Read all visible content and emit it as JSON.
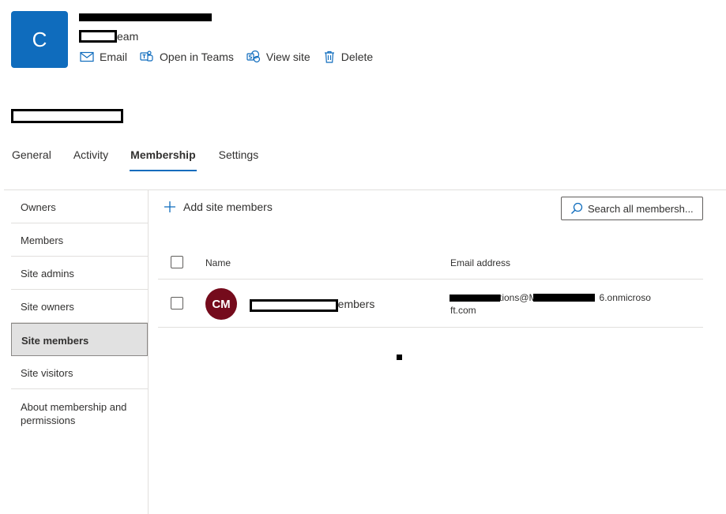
{
  "group": {
    "avatar_letter": "C",
    "subtitle_suffix": "eam"
  },
  "actions": [
    {
      "label": "Email",
      "icon": "mail-icon"
    },
    {
      "label": "Open in Teams",
      "icon": "teams-icon"
    },
    {
      "label": "View site",
      "icon": "sharepoint-icon"
    },
    {
      "label": "Delete",
      "icon": "trash-icon"
    }
  ],
  "tabs": [
    {
      "label": "General"
    },
    {
      "label": "Activity"
    },
    {
      "label": "Membership",
      "active": true
    },
    {
      "label": "Settings"
    }
  ],
  "sidebar": {
    "items": [
      {
        "label": "Owners"
      },
      {
        "label": "Members"
      },
      {
        "label": "Site admins"
      },
      {
        "label": "Site owners"
      },
      {
        "label": "Site members",
        "active": true
      },
      {
        "label": "Site visitors"
      },
      {
        "label": "About membership and permissions"
      }
    ]
  },
  "toolbar": {
    "add_label": "Add site members",
    "search_placeholder": "Search all membersh..."
  },
  "table": {
    "col_name": "Name",
    "col_email": "Email address",
    "rows": [
      {
        "initials": "CM",
        "name_suffix": "Members",
        "email_line1_mid": "tions@M",
        "email_line1_end": "6.onmicroso",
        "email_line2": "ft.com"
      }
    ]
  },
  "colors": {
    "accent": "#0f6cbd",
    "member_avatar": "#750b1c"
  }
}
